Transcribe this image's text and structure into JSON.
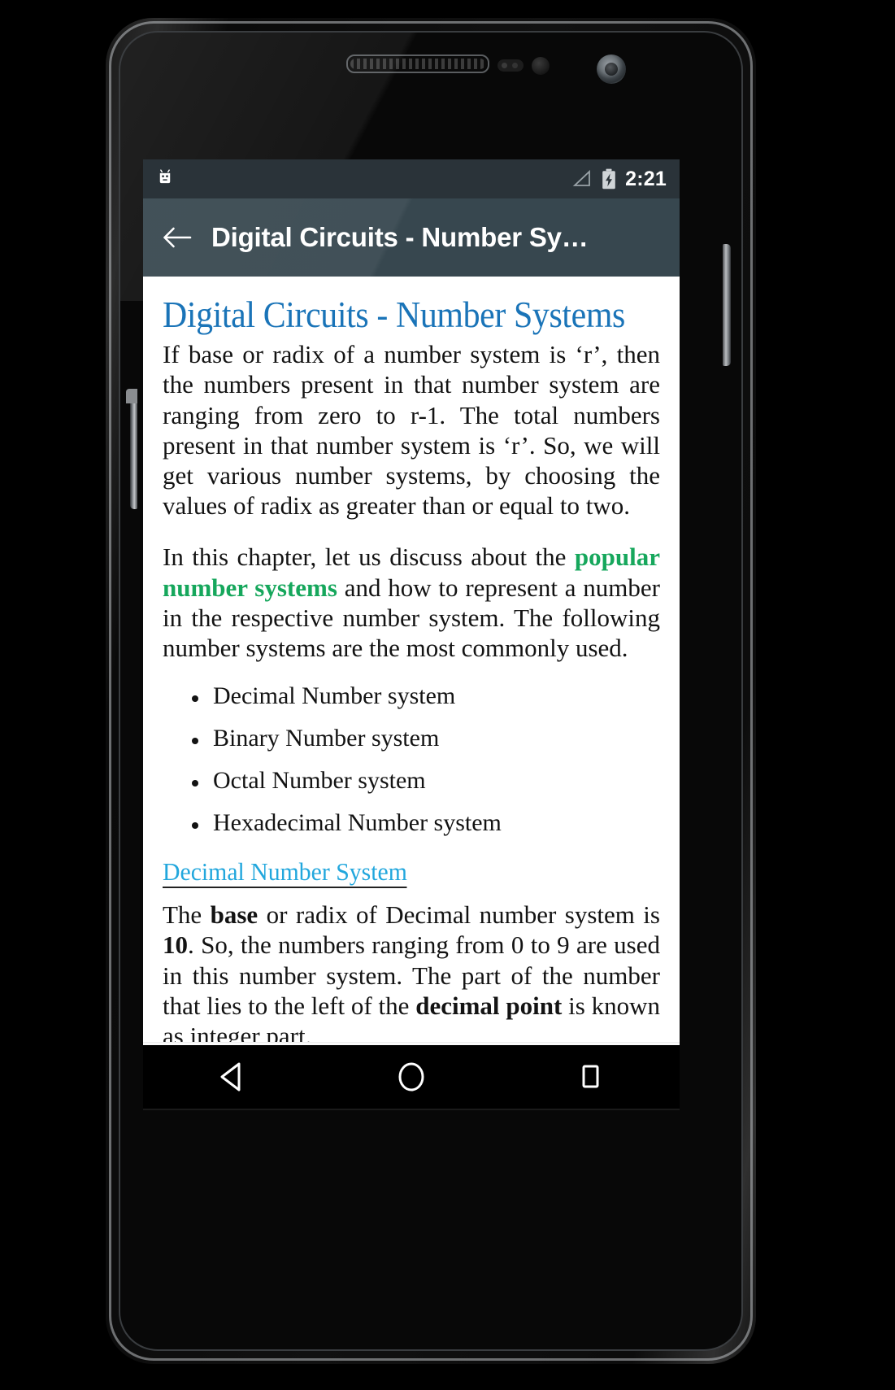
{
  "device": {
    "frame_name": "android-phone-mockup",
    "hardware": {
      "earpiece": "earpiece-speaker",
      "proximity_sensor": "proximity-sensor",
      "light_sensor": "ambient-light-sensor",
      "front_camera": "front-camera",
      "power_button": "power-button",
      "volume_button": "volume-rocker"
    }
  },
  "status_bar": {
    "app_icon": "android-robot-icon",
    "signal_icon": "signal-triangle-icon",
    "battery_icon": "battery-charging-icon",
    "time": "2:21",
    "background_color": "#2a3339"
  },
  "action_bar": {
    "back_icon": "back-arrow-icon",
    "title": "Digital Circuits - Number Sy…",
    "background_color": "#37474f",
    "title_color": "#ffffff"
  },
  "article": {
    "title": "Digital Circuits - Number Systems",
    "title_color": "#1a74b8",
    "paragraph_1": "If base or radix of a number system is ‘r’, then the numbers present in that number system are ranging from zero to r-1. The total numbers present in that number system is ‘r’. So, we will get various number systems, by choosing the values of radix as greater than or equal to two.",
    "paragraph_2": {
      "before": "In this chapter, let us discuss about the ",
      "highlight": "popular number systems",
      "highlight_color": "#16a75c",
      "after": " and how to represent a number in the respective number system. The following number systems are the most commonly used."
    },
    "bullets": [
      "Decimal Number system",
      "Binary Number system",
      "Octal Number system",
      "Hexadecimal Number system"
    ],
    "section_link": {
      "label": "Decimal Number System",
      "color": "#22a7dd"
    },
    "paragraph_3": {
      "part_1": "The ",
      "bold_1": "base",
      "part_2": " or radix of Decimal number system is ",
      "bold_2": "10",
      "part_3": ". So, the numbers ranging from 0 to 9 are used in this number system. The part of the number that lies to the left of the ",
      "bold_3": "decimal point",
      "part_4": " is known as integer part."
    }
  },
  "nav_bar": {
    "background_color": "#000000",
    "buttons": [
      {
        "name": "back",
        "icon": "nav-back-triangle-icon"
      },
      {
        "name": "home",
        "icon": "nav-home-circle-icon"
      },
      {
        "name": "recents",
        "icon": "nav-recents-square-icon"
      }
    ]
  }
}
